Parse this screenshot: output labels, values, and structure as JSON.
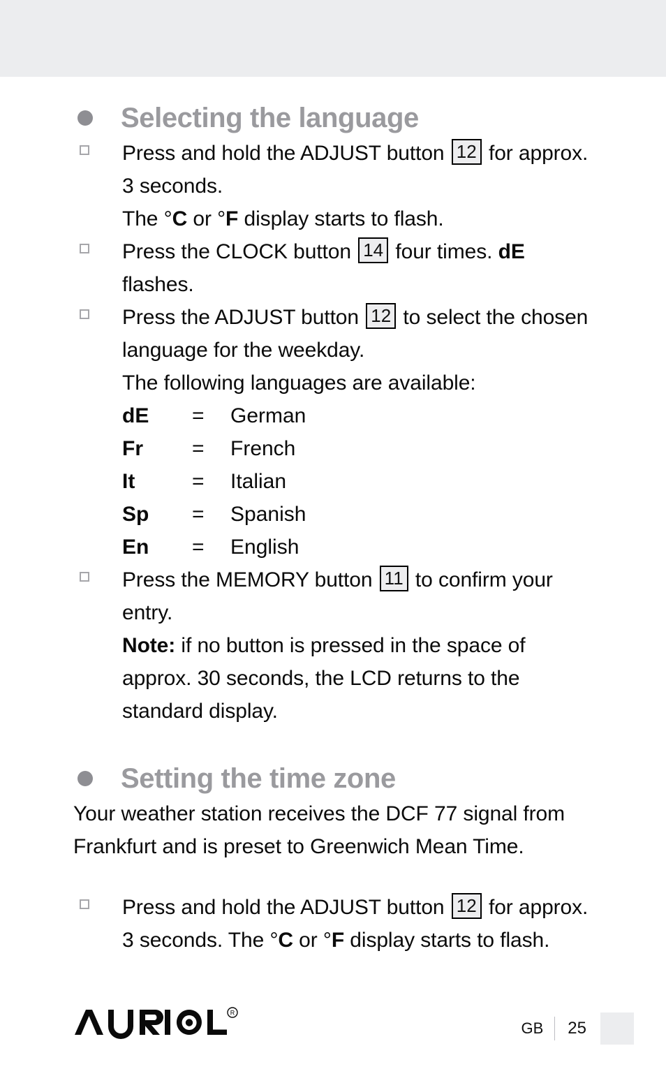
{
  "document": {
    "brand": "AURIOL",
    "brand_trademark": "®",
    "footer": {
      "language_code": "GB",
      "page_number": "25"
    }
  },
  "sections": [
    {
      "heading": "Selecting the language",
      "steps": [
        {
          "lines": [
            "Press and hold the ADJUST button  12  for approx.",
            "3 seconds.",
            "The  °C  or  °F  display starts to flash."
          ],
          "line_parts": [
            [
              "Press and hold the ADJUST button ",
              "12",
              " for approx."
            ],
            [
              "3 seconds."
            ],
            [
              "The ",
              "°",
              "C",
              " or ",
              "°",
              "F",
              " display starts to flash."
            ]
          ]
        },
        {
          "line_parts": [
            [
              "Press the CLOCK button ",
              "14",
              " four times. ",
              "dE"
            ],
            [
              "flashes."
            ]
          ]
        },
        {
          "line_parts": [
            [
              "Press the ADJUST button ",
              "12",
              " to select the chosen"
            ],
            [
              "language for the weekday."
            ],
            [
              "The following languages are available:"
            ]
          ]
        },
        {
          "line_parts": [
            [
              "Press the MEMORY button ",
              "11",
              " to confirm your"
            ],
            [
              "entry."
            ],
            [
              "Note:",
              " if no button is pressed in the space of"
            ],
            [
              "approx. 30 seconds, the LCD returns to the"
            ],
            [
              "standard display."
            ]
          ]
        }
      ],
      "language_table": {
        "rows": [
          {
            "code": "dE",
            "equals": "=",
            "language": "German"
          },
          {
            "code": "Fr",
            "equals": "=",
            "language": "French"
          },
          {
            "code": "It",
            "equals": "=",
            "language": "Italian"
          },
          {
            "code": "Sp",
            "equals": "=",
            "language": "Spanish"
          },
          {
            "code": "En",
            "equals": "=",
            "language": "English"
          }
        ]
      }
    },
    {
      "heading": "Setting the time zone",
      "intro": [
        "Your weather station receives the DCF 77 signal from",
        "Frankfurt and is preset to Greenwich Mean Time."
      ],
      "steps": [
        {
          "line_parts": [
            [
              "Press and hold the ADJUST button ",
              "12",
              " for approx."
            ],
            [
              "3 seconds. The ",
              "°",
              "C",
              " or ",
              "°",
              "F",
              " display starts to flash."
            ]
          ]
        }
      ]
    }
  ],
  "text": {
    "s1_heading": "Selecting the language",
    "s1_l1a": "Press and hold the ADJUST button",
    "s1_l1_ref": "12",
    "s1_l1b": "for approx.",
    "s1_l2": "3 seconds.",
    "s1_l3a": "The",
    "s1_deg1": "°",
    "s1_c": "C",
    "s1_l3b": "or",
    "s1_deg2": "°",
    "s1_f": "F",
    "s1_l3c": "display starts to flash.",
    "s2_l1a": "Press the CLOCK button",
    "s2_l1_ref": "14",
    "s2_l1b": "four times.",
    "s2_l1_bold": "dE",
    "s2_l2": "flashes.",
    "s3_l1a": "Press the ADJUST button",
    "s3_l1_ref": "12",
    "s3_l1b": "to select the chosen",
    "s3_l2": "language for the weekday.",
    "s3_l3": "The following languages are available:",
    "s4_l1a": "Press the MEMORY button",
    "s4_l1_ref": "11",
    "s4_l1b": "to confirm your",
    "s4_l2": "entry.",
    "s4_note_label": "Note:",
    "s4_note_a": "if no button is pressed in the space of",
    "s4_note_b": "approx. 30 seconds, the LCD returns to the",
    "s4_note_c": "standard display.",
    "s5_heading": "Setting the time zone",
    "s5_p1": "Your weather station receives the DCF 77 signal from",
    "s5_p2": "Frankfurt and is preset to Greenwich Mean Time.",
    "s6_l1a": "Press and hold the ADJUST button",
    "s6_l1_ref": "12",
    "s6_l1b": "for approx.",
    "s6_l2a": "3 seconds. The",
    "s6_deg1": "°",
    "s6_c": "C",
    "s6_l2b": "or",
    "s6_deg2": "°",
    "s6_f": "F",
    "s6_l2c": "display starts to flash."
  },
  "languages": [
    {
      "code": "dE",
      "equals": "=",
      "name": "German"
    },
    {
      "code": "Fr",
      "equals": "=",
      "name": "French"
    },
    {
      "code": "It",
      "equals": "=",
      "name": "Italian"
    },
    {
      "code": "Sp",
      "equals": "=",
      "name": "Spanish"
    },
    {
      "code": "En",
      "equals": "=",
      "name": "English"
    }
  ],
  "footer": {
    "brand": "AURIOL",
    "trademark": "®",
    "lang": "GB",
    "page": "25"
  },
  "colors": {
    "heading_gray": "#9A9A9E",
    "band_gray": "#ECEDEF",
    "refbox_fill": "#EDEDEF",
    "body_black": "#0B0B0B"
  }
}
